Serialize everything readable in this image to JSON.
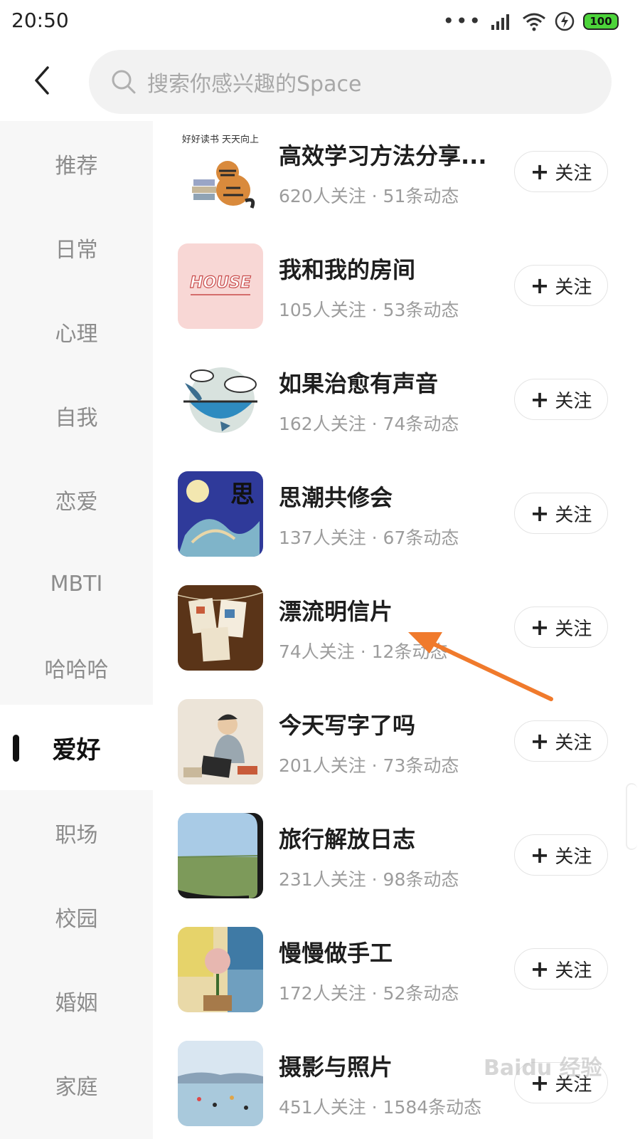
{
  "status_bar": {
    "time": "20:50",
    "battery": "100"
  },
  "search": {
    "placeholder": "搜索你感兴趣的Space"
  },
  "sidebar": {
    "items": [
      {
        "label": "推荐"
      },
      {
        "label": "日常"
      },
      {
        "label": "心理"
      },
      {
        "label": "自我"
      },
      {
        "label": "恋爱"
      },
      {
        "label": "MBTI"
      },
      {
        "label": "哈哈哈"
      },
      {
        "label": "爱好",
        "active": true
      },
      {
        "label": "职场"
      },
      {
        "label": "校园"
      },
      {
        "label": "婚姻"
      },
      {
        "label": "家庭"
      }
    ]
  },
  "follow_label": "关注",
  "spaces": [
    {
      "title": "高效学习方法分享...",
      "stats": "620人关注 · 51条动态",
      "thumb_text": "好好读书 天天向上"
    },
    {
      "title": "我和我的房间",
      "stats": "105人关注 · 53条动态",
      "thumb_text": "HOUSE"
    },
    {
      "title": "如果治愈有声音",
      "stats": "162人关注 · 74条动态"
    },
    {
      "title": "思潮共修会",
      "stats": "137人关注 · 67条动态",
      "thumb_text": "思 潮"
    },
    {
      "title": "漂流明信片",
      "stats": "74人关注 · 12条动态"
    },
    {
      "title": "今天写字了吗",
      "stats": "201人关注 · 73条动态"
    },
    {
      "title": "旅行解放日志",
      "stats": "231人关注 · 98条动态"
    },
    {
      "title": "慢慢做手工",
      "stats": "172人关注 · 52条动态"
    },
    {
      "title": "摄影与照片",
      "stats": "451人关注 · 1584条动态"
    }
  ],
  "watermark": "Baidu 经验",
  "colors": {
    "accent_arrow": "#f07a2c",
    "battery": "#4cd43a"
  }
}
